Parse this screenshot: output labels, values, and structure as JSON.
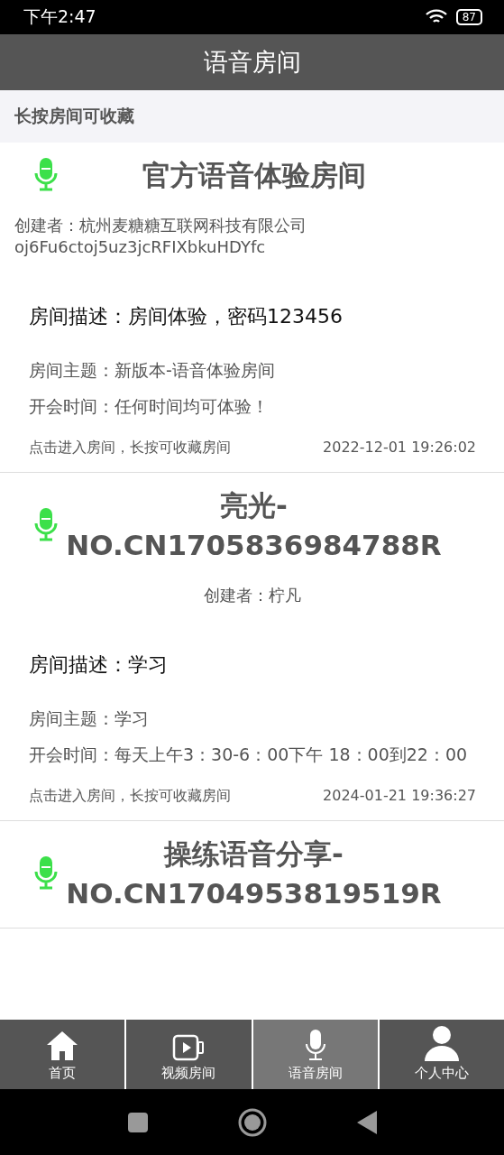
{
  "status_bar": {
    "time": "下午2:47",
    "battery": "87"
  },
  "header": {
    "title": "语音房间"
  },
  "notice": "长按房间可收藏",
  "rooms": [
    {
      "title": "官方语音体验房间",
      "creator": "创建者：杭州麦糖糖互联网科技有限公司oj6Fu6ctoj5uz3jcRFIXbkuHDYfc",
      "description": "房间描述：房间体验，密码123456",
      "topic": "房间主题：新版本-语音体验房间",
      "meeting_time": "开会时间：任何时间均可体验！",
      "hint": "点击进入房间，长按可收藏房间",
      "date": "2022-12-01 19:26:02"
    },
    {
      "title": "亮光-NO.CN1705836984788R",
      "creator": "创建者：柠凡",
      "description": "房间描述：学习",
      "topic": "房间主题：学习",
      "meeting_time": "开会时间：每天上午3：30-6：00下午 18：00到22：00",
      "hint": "点击进入房间，长按可收藏房间",
      "date": "2024-01-21 19:36:27"
    },
    {
      "title": "操练语音分享-NO.CN1704953819519R"
    }
  ],
  "tab_bar": [
    {
      "label": "首页",
      "kind": "home",
      "selected": false
    },
    {
      "label": "视频房间",
      "kind": "video",
      "selected": false
    },
    {
      "label": "语音房间",
      "kind": "voice",
      "selected": true
    },
    {
      "label": "个人中心",
      "kind": "profile",
      "selected": false
    }
  ]
}
